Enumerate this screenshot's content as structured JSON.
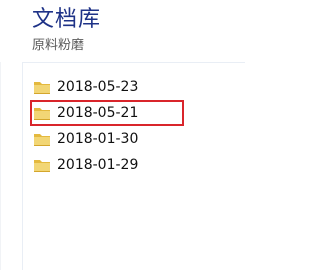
{
  "library": {
    "title": "文档库",
    "subtitle": "原料粉磨"
  },
  "folders": [
    {
      "name": "2018-05-23",
      "icon": "folder-icon",
      "selected": false
    },
    {
      "name": "2018-05-21",
      "icon": "folder-icon",
      "selected": true
    },
    {
      "name": "2018-01-30",
      "icon": "folder-icon",
      "selected": false
    },
    {
      "name": "2018-01-29",
      "icon": "folder-icon",
      "selected": false
    }
  ],
  "colors": {
    "title": "#1e3287",
    "highlight_box": "#d9252b",
    "folder_fill": "#f2d675",
    "folder_back": "#e4b93e"
  }
}
